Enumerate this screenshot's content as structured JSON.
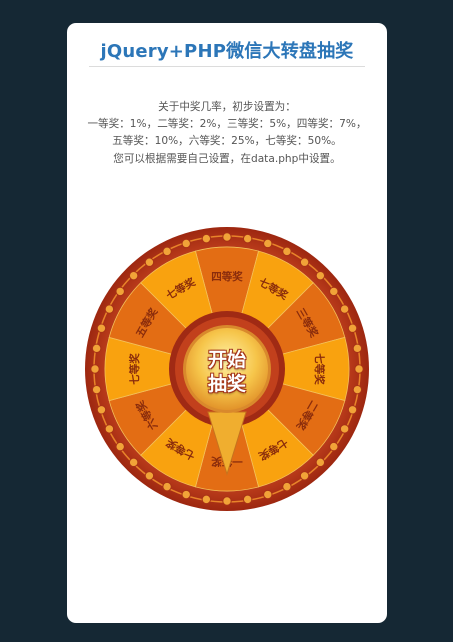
{
  "page": {
    "title": "jQuery+PHP微信大转盘抽奖",
    "description_lines": [
      "关于中奖几率，初步设置为：",
      "一等奖：1%，二等奖：2%，三等奖：5%，四等奖：7%，",
      "五等奖：10%，六等奖：25%，七等奖：50%。",
      "您可以根据需要自己设置，在data.php中设置。"
    ]
  },
  "wheel": {
    "segments": [
      "四等奖",
      "七等奖",
      "三等奖",
      "七等奖",
      "二等奖",
      "七等奖",
      "一等奖",
      "七等奖",
      "六等奖",
      "七等奖",
      "五等奖",
      "七等奖"
    ],
    "start_button": {
      "line1": "开始",
      "line2": "抽奖"
    },
    "colors": {
      "outer_ring": "#b8351c",
      "ring_dark": "#8c1f10",
      "segment_light": "#f9a20f",
      "segment_dark": "#e36d14",
      "segment_text": "#8a2c0c",
      "center_gold": "#f6c54a",
      "pointer": "#f3b437"
    },
    "icons": [
      "wheel-pointer-icon"
    ]
  }
}
